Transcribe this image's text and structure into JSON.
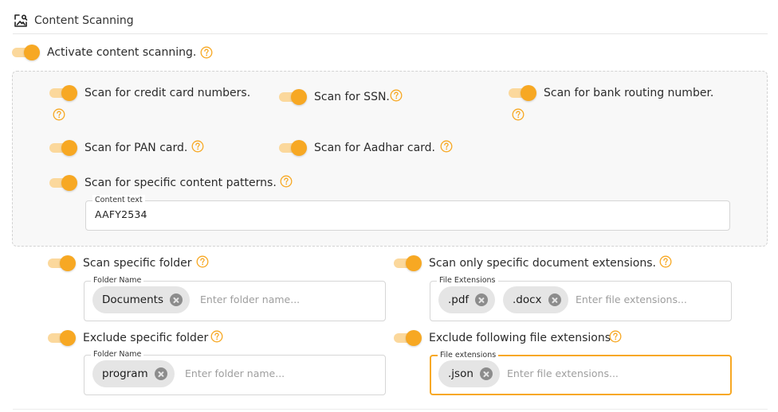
{
  "header": {
    "title": "Content Scanning",
    "icon": "scan-image-icon"
  },
  "master_toggle": {
    "label": "Activate content scanning.",
    "enabled": true
  },
  "options": {
    "credit_card": {
      "label": "Scan for credit card numbers.",
      "enabled": true
    },
    "ssn": {
      "label": "Scan for SSN.",
      "enabled": true
    },
    "bank_routing": {
      "label": "Scan for bank routing number.",
      "enabled": true
    },
    "pan_card": {
      "label": "Scan for PAN card.",
      "enabled": true
    },
    "aadhar_card": {
      "label": "Scan for Aadhar card.",
      "enabled": true
    },
    "patterns": {
      "label": "Scan for specific content patterns.",
      "enabled": true
    }
  },
  "content_text": {
    "legend": "Content text",
    "value": "AAFY2534"
  },
  "scan_folder": {
    "label": "Scan specific folder",
    "enabled": true,
    "legend": "Folder Name",
    "chips": [
      "Documents"
    ],
    "placeholder": "Enter folder name..."
  },
  "scan_extensions": {
    "label": "Scan only specific document extensions.",
    "enabled": true,
    "legend": "File Extensions",
    "chips": [
      ".pdf",
      ".docx"
    ],
    "placeholder": "Enter file extensions..."
  },
  "exclude_folder": {
    "label": "Exclude specific folder",
    "enabled": true,
    "legend": "Folder Name",
    "chips": [
      "program"
    ],
    "placeholder": "Enter folder name..."
  },
  "exclude_extensions": {
    "label": "Exclude following file extensions",
    "enabled": true,
    "legend": "File extensions",
    "chips": [
      ".json"
    ],
    "placeholder": "Enter file extensions..."
  },
  "colors": {
    "accent": "#f7a823",
    "accent_light": "#fbd89c",
    "panel_bg": "#f8f8f8",
    "chip_bg": "#e5e5e5"
  }
}
